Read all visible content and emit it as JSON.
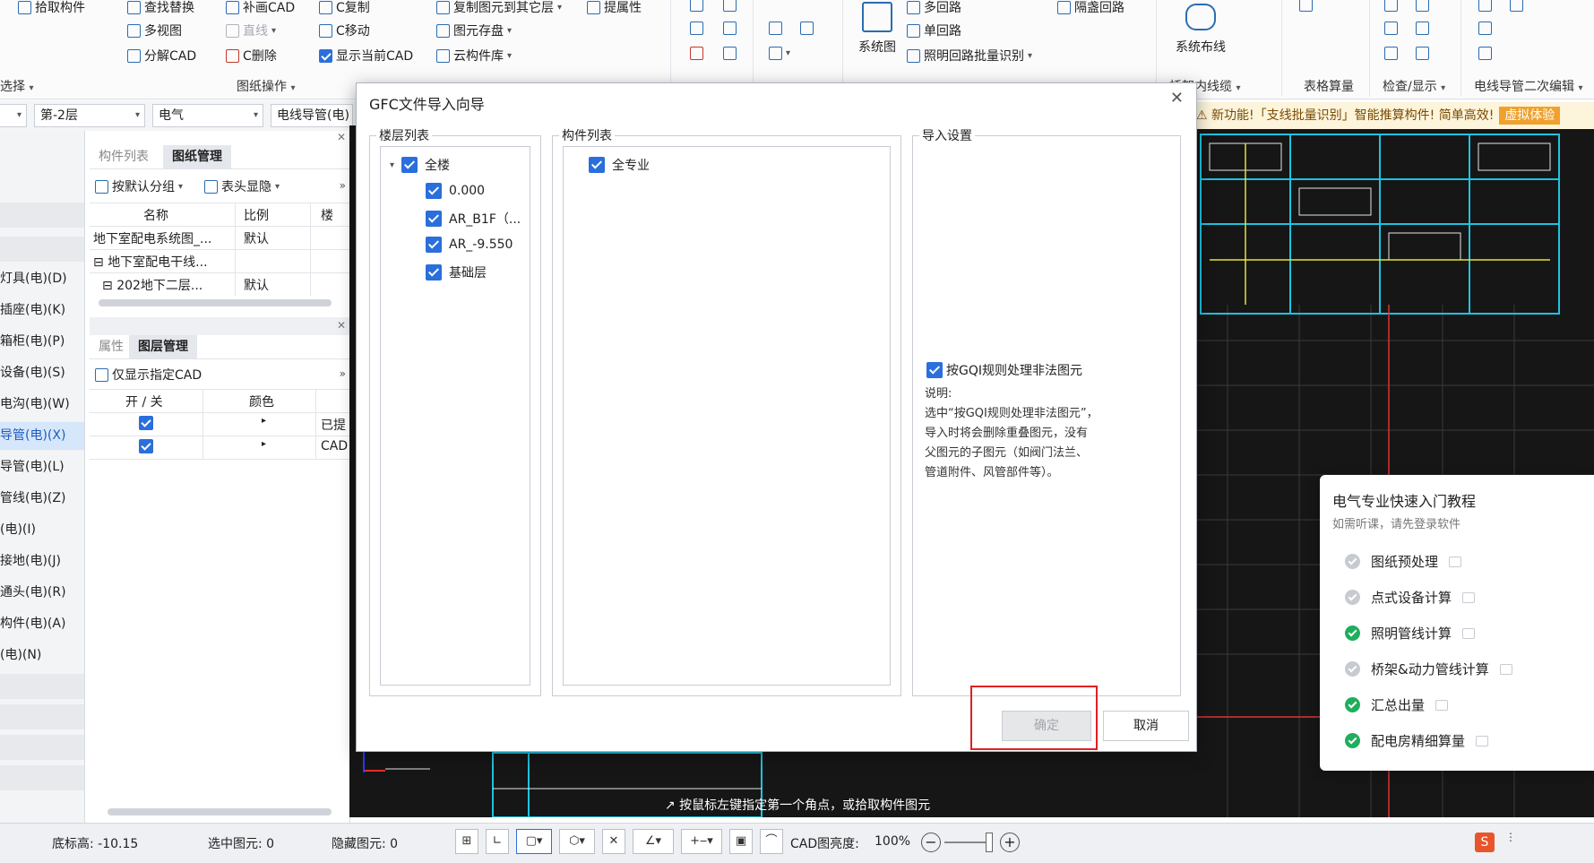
{
  "ribbon": {
    "row1": [
      "拾取构件",
      "查找替换",
      "补画CAD",
      "C复制",
      "复制图元到其它层",
      "提属性",
      "多回路",
      "隔盏回路"
    ],
    "row2": [
      "多视图",
      "直线",
      "C移动",
      "图元存盘",
      "单回路"
    ],
    "row3": [
      "分解CAD",
      "C删除",
      "显示当前CAD",
      "云构件库",
      "照明回路批量识别"
    ],
    "big_buttons": [
      "系统图",
      "系统布线"
    ],
    "groups": [
      "选择",
      "图纸操作",
      "桥架内线缆",
      "表格算量",
      "检查/显示",
      "电线导管二次编辑"
    ]
  },
  "selectors": {
    "floor": "第-2层",
    "discipline": "电气",
    "component_type": "电线导管(电)"
  },
  "notice": {
    "text": "新功能!「支线批量识别」智能推算构件! 简单高效!",
    "button": "虚拟体验"
  },
  "left_list": [
    "灯具(电)(D)",
    "插座(电)(K)",
    "箱柜(电)(P)",
    "设备(电)(S)",
    "电沟(电)(W)",
    "导管(电)(X)",
    "导管(电)(L)",
    "管线(电)(Z)",
    "(电)(I)",
    "接地(电)(J)",
    "通头(电)(R)",
    "构件(电)(A)",
    "(电)(N)"
  ],
  "drawing_panel": {
    "tabs": [
      "构件列表",
      "图纸管理"
    ],
    "tools": [
      "按默认分组",
      "表头显隐"
    ],
    "columns": [
      "名称",
      "比例",
      "楼"
    ],
    "rows": [
      {
        "name": "地下室配电系统图_...",
        "scale": "默认"
      },
      {
        "name": "地下室配电干线...",
        "scale": ""
      },
      {
        "name": "202地下二层...",
        "scale": "默认"
      }
    ]
  },
  "layer_panel": {
    "tabs": [
      "属性",
      "图层管理"
    ],
    "tool": "仅显示指定CAD",
    "columns": [
      "开 / 关",
      "颜色"
    ],
    "rows": [
      {
        "name": "已提"
      },
      {
        "name": "CAD"
      }
    ]
  },
  "dialog": {
    "title": "GFC文件导入向导",
    "floor_list": {
      "title": "楼层列表",
      "root": "全楼",
      "items": [
        "0.000",
        "AR_B1F（...",
        "AR_-9.550",
        "基础层"
      ]
    },
    "component_list": {
      "title": "构件列表",
      "root": "全专业"
    },
    "import_settings": {
      "title": "导入设置",
      "option": "按GQI规则处理非法图元",
      "note_title": "说明:",
      "note_lines": [
        "选中“按GQI规则处理非法图元”，",
        "导入时将会删除重叠图元，没有",
        "父图元的子图元（如阀门法兰、",
        "管道附件、风管部件等）。"
      ]
    },
    "ok_label": "确定",
    "cancel_label": "取消"
  },
  "tutorial": {
    "title": "电气专业快速入门教程",
    "subtitle": "如需听课，请先登录软件",
    "items": [
      {
        "label": "图纸预处理",
        "done": false
      },
      {
        "label": "点式设备计算",
        "done": false
      },
      {
        "label": "照明管线计算",
        "done": true
      },
      {
        "label": "桥架&动力管线计算",
        "done": false
      },
      {
        "label": "汇总出量",
        "done": true
      },
      {
        "label": "配电房精细算量",
        "done": true
      }
    ]
  },
  "canvas_hint": "按鼠标左键指定第一个角点，或拾取构件图元",
  "status": {
    "base_elevation": "底标高: -10.15",
    "selected": "选中图元: 0",
    "hidden": "隐藏图元: 0",
    "brightness_label": "CAD图亮度:",
    "brightness_value": "100%"
  },
  "colors": {
    "accent": "#2a6fdb",
    "done": "#1fae5b",
    "highlight_box": "#e02020",
    "canvas_bg": "#161616"
  }
}
